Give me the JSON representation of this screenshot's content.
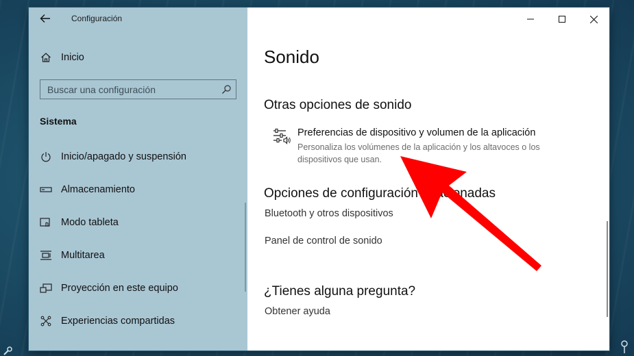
{
  "window": {
    "title": "Configuración",
    "controls": {
      "minimize": "minimize",
      "maximize": "maximize",
      "close": "close"
    }
  },
  "sidebar": {
    "home_label": "Inicio",
    "search_placeholder": "Buscar una configuración",
    "section_label": "Sistema",
    "items": [
      {
        "label": "Inicio/apagado y suspensión",
        "icon": "power-icon"
      },
      {
        "label": "Almacenamiento",
        "icon": "storage-icon"
      },
      {
        "label": "Modo tableta",
        "icon": "tablet-mode-icon"
      },
      {
        "label": "Multitarea",
        "icon": "multitask-icon"
      },
      {
        "label": "Proyección en este equipo",
        "icon": "projection-icon"
      },
      {
        "label": "Experiencias compartidas",
        "icon": "shared-experiences-icon"
      }
    ]
  },
  "main": {
    "page_title": "Sonido",
    "other_options_heading": "Otras opciones de sonido",
    "pref_title": "Preferencias de dispositivo y volumen de la aplicación",
    "pref_desc": "Personaliza los volúmenes de la aplicación y los altavoces o los dispositivos que usan.",
    "related_heading": "Opciones de configuración relacionadas",
    "related_links": [
      "Bluetooth y otros dispositivos",
      "Panel de control de sonido"
    ],
    "question_heading": "¿Tienes alguna pregunta?",
    "help_link": "Obtener ayuda"
  },
  "annotation": {
    "color": "#ff0000",
    "icon": "red-arrow"
  },
  "colors": {
    "sidebar_bg": "#a9c6d3",
    "main_bg": "#ffffff"
  }
}
